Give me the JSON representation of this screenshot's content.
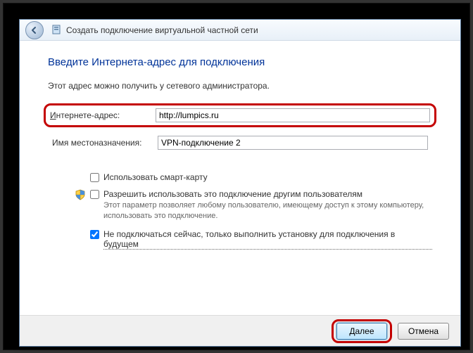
{
  "window": {
    "title": "Создать подключение виртуальной частной сети"
  },
  "heading": "Введите Интернета-адрес для подключения",
  "subtext": "Этот адрес можно получить у сетевого администратора.",
  "fields": {
    "address": {
      "label_pre": "И",
      "label_rest": "нтернете-адрес:",
      "value": "http://lumpics.ru"
    },
    "destination": {
      "label": "Имя местоназначения:",
      "value": "VPN-подключение 2"
    }
  },
  "checkboxes": {
    "smartcard": {
      "label": "Использовать смарт-карту",
      "checked": false
    },
    "allow_others": {
      "label": "Разрешить использовать это подключение другим пользователям",
      "hint": "Этот параметр позволяет любому пользователю, имеющему доступ к этому компьютеру, использовать это подключение.",
      "checked": false
    },
    "dont_connect": {
      "label": "Не подключаться сейчас, только выполнить установку для подключения в будущем",
      "checked": true
    }
  },
  "buttons": {
    "next": "Далее",
    "cancel": "Отмена"
  }
}
